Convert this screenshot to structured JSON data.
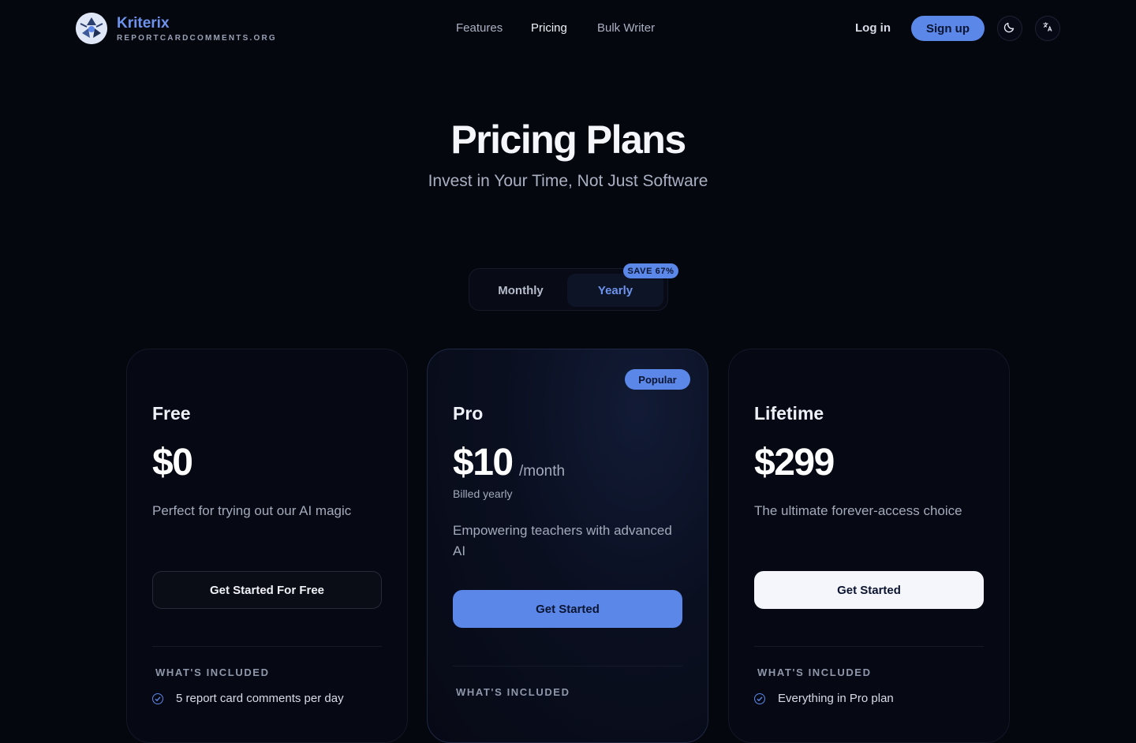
{
  "brand": {
    "name": "Kriterix",
    "subtitle": "REPORTCARDCOMMENTS.ORG"
  },
  "nav": {
    "features": "Features",
    "pricing": "Pricing",
    "bulk_writer": "Bulk Writer"
  },
  "auth": {
    "login": "Log in",
    "signup": "Sign up"
  },
  "icons": {
    "theme": "moon-icon",
    "language": "translate-icon",
    "check": "check-circle-icon"
  },
  "hero": {
    "title": "Pricing Plans",
    "subtitle": "Invest in Your Time, Not Just Software"
  },
  "billing_toggle": {
    "monthly": "Monthly",
    "yearly": "Yearly",
    "selected": "Yearly",
    "badge": "SAVE 67%"
  },
  "colors": {
    "accent": "#5b87e8",
    "background": "#05070f"
  },
  "plans": [
    {
      "name": "Free",
      "price": "$0",
      "description": "Perfect for trying out our AI magic",
      "cta": "Get Started For Free",
      "included_label": "WHAT'S INCLUDED",
      "features": [
        "5 report card comments per day"
      ]
    },
    {
      "name": "Pro",
      "badge": "Popular",
      "price": "$10",
      "period": "/month",
      "billed": "Billed yearly",
      "description": "Empowering teachers with advanced AI",
      "cta": "Get Started",
      "included_label": "WHAT'S INCLUDED",
      "features": []
    },
    {
      "name": "Lifetime",
      "price": "$299",
      "description": "The ultimate forever-access choice",
      "cta": "Get Started",
      "included_label": "WHAT'S INCLUDED",
      "features": [
        "Everything in Pro plan"
      ]
    }
  ]
}
